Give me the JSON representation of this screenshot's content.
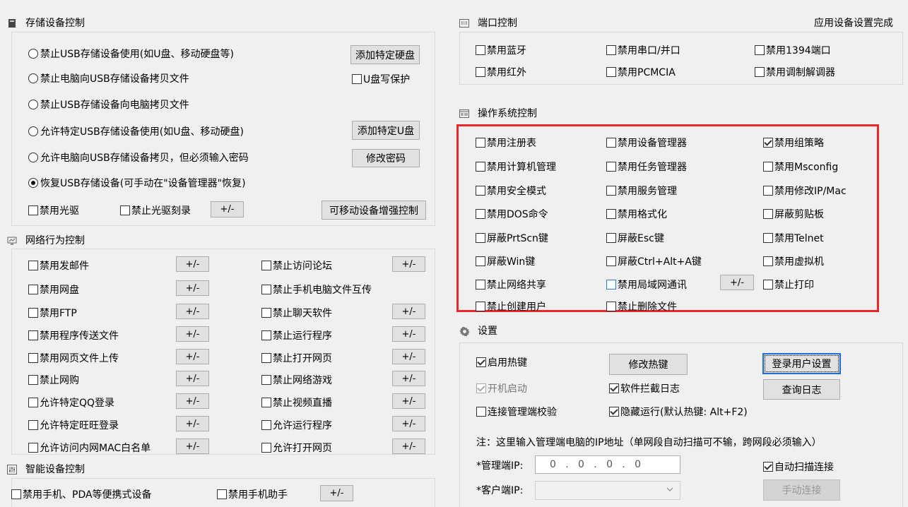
{
  "storage": {
    "title": "存储设备控制",
    "radio1": "禁止USB存储设备使用(如U盘、移动硬盘等)",
    "radio2": "禁止电脑向USB存储设备拷贝文件",
    "radio3": "禁止USB存储设备向电脑拷贝文件",
    "radio4": "允许特定USB存储设备使用(如U盘、移动硬盘)",
    "radio5": "允许电脑向USB存储设备拷贝，但必须输入密码",
    "radio6": "恢复USB存储设备(可手动在\"设备管理器\"恢复)",
    "add_disk": "添加特定硬盘",
    "write_protect": "U盘写保护",
    "add_udisk": "添加特定U盘",
    "change_pwd": "修改密码",
    "disable_cd": "禁用光驱",
    "disable_burn": "禁止光驱刻录",
    "pm": "+/-",
    "removable": "可移动设备增强控制"
  },
  "network": {
    "title": "网络行为控制",
    "pm": "+/-",
    "left": [
      "禁用发邮件",
      "禁用网盘",
      "禁用FTP",
      "禁用程序传送文件",
      "禁用网页文件上传",
      "禁止网购",
      "允许特定QQ登录",
      "允许特定旺旺登录",
      "允许访问内网MAC白名单"
    ],
    "right": [
      "禁止访问论坛",
      "禁止手机电脑文件互传",
      "禁止聊天软件",
      "禁止运行程序",
      "禁止打开网页",
      "禁止网络游戏",
      "禁止视频直播",
      "允许运行程序",
      "允许打开网页"
    ]
  },
  "smart": {
    "title": "智能设备控制",
    "phone": "禁用手机、PDA等便携式设备",
    "helper": "禁用手机助手",
    "pm": "+/-"
  },
  "port": {
    "title": "端口控制",
    "status": "应用设备设置完成",
    "items": [
      "禁用蓝牙",
      "禁用串口/并口",
      "禁用1394端口",
      "禁用红外",
      "禁用PCMCIA",
      "禁用调制解调器"
    ]
  },
  "os": {
    "title": "操作系统控制",
    "pm": "+/-",
    "col1": [
      "禁用注册表",
      "禁用计算机管理",
      "禁用安全模式",
      "禁用DOS命令",
      "屏蔽PrtScn键",
      "屏蔽Win键",
      "禁止网络共享",
      "禁止创建用户"
    ],
    "col2": [
      "禁用设备管理器",
      "禁用任务管理器",
      "禁用服务管理",
      "禁用格式化",
      "屏蔽Esc键",
      "屏蔽Ctrl+Alt+A键",
      "禁用局域网通讯",
      "禁止删除文件"
    ],
    "col3": [
      "禁用组策略",
      "禁用Msconfig",
      "禁用修改IP/Mac",
      "屏蔽剪贴板",
      "禁用Telnet",
      "禁用虚拟机",
      "禁止打印"
    ]
  },
  "settings": {
    "title": "设置",
    "hotkey": "启用热键",
    "autostart": "开机启动",
    "verify": "连接管理端校验",
    "modify_hotkey": "修改热键",
    "intercept_log": "软件拦截日志",
    "hidden_run": "隐藏运行(默认热键: Alt+F2)",
    "login_user": "登录用户设置",
    "query_log": "查询日志",
    "note": "注：这里输入管理端电脑的IP地址（单网段自动扫描可不输，跨网段必须输入）",
    "admin_ip_label": "*管理端IP:",
    "admin_ip_value": "0   .   0   .   0   .   0",
    "client_ip_label": "*客户端IP:",
    "auto_scan": "自动扫描连接",
    "manual_connect": "手动连接"
  }
}
